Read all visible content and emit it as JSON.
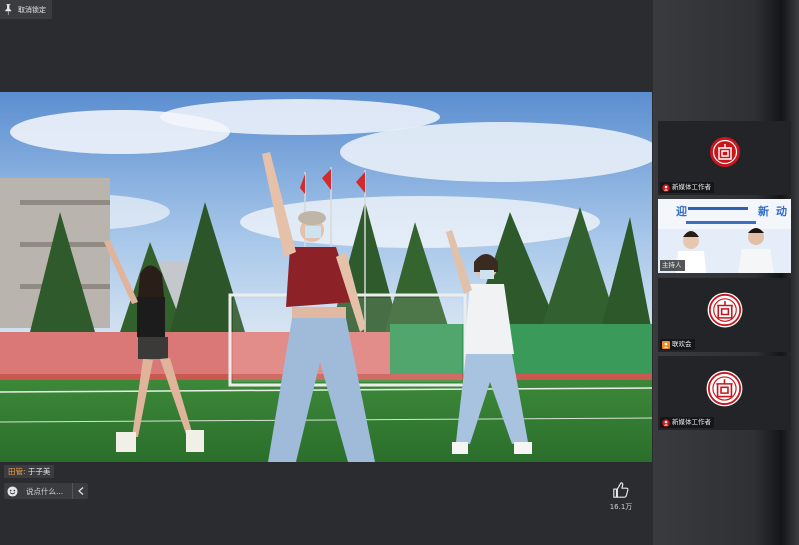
{
  "toolbar": {
    "unpin_label": "取消锁定"
  },
  "main_speaker": {
    "role": "田管:",
    "name": "于子美"
  },
  "comment": {
    "placeholder": "说点什么..."
  },
  "likes": {
    "count": "16.1万"
  },
  "participants": [
    {
      "label": "新媒体工作者",
      "type": "logo"
    },
    {
      "label": "主持人",
      "type": "video"
    },
    {
      "label": "联欢会",
      "type": "logo"
    },
    {
      "label": "新媒体工作者",
      "type": "logo"
    }
  ],
  "host_banner": {
    "text_a": "迎",
    "text_b": "新",
    "text_c": "动"
  },
  "colors": {
    "accent": "#f0a24a",
    "seal": "#c8161d",
    "panel": "#2a2c2f"
  }
}
